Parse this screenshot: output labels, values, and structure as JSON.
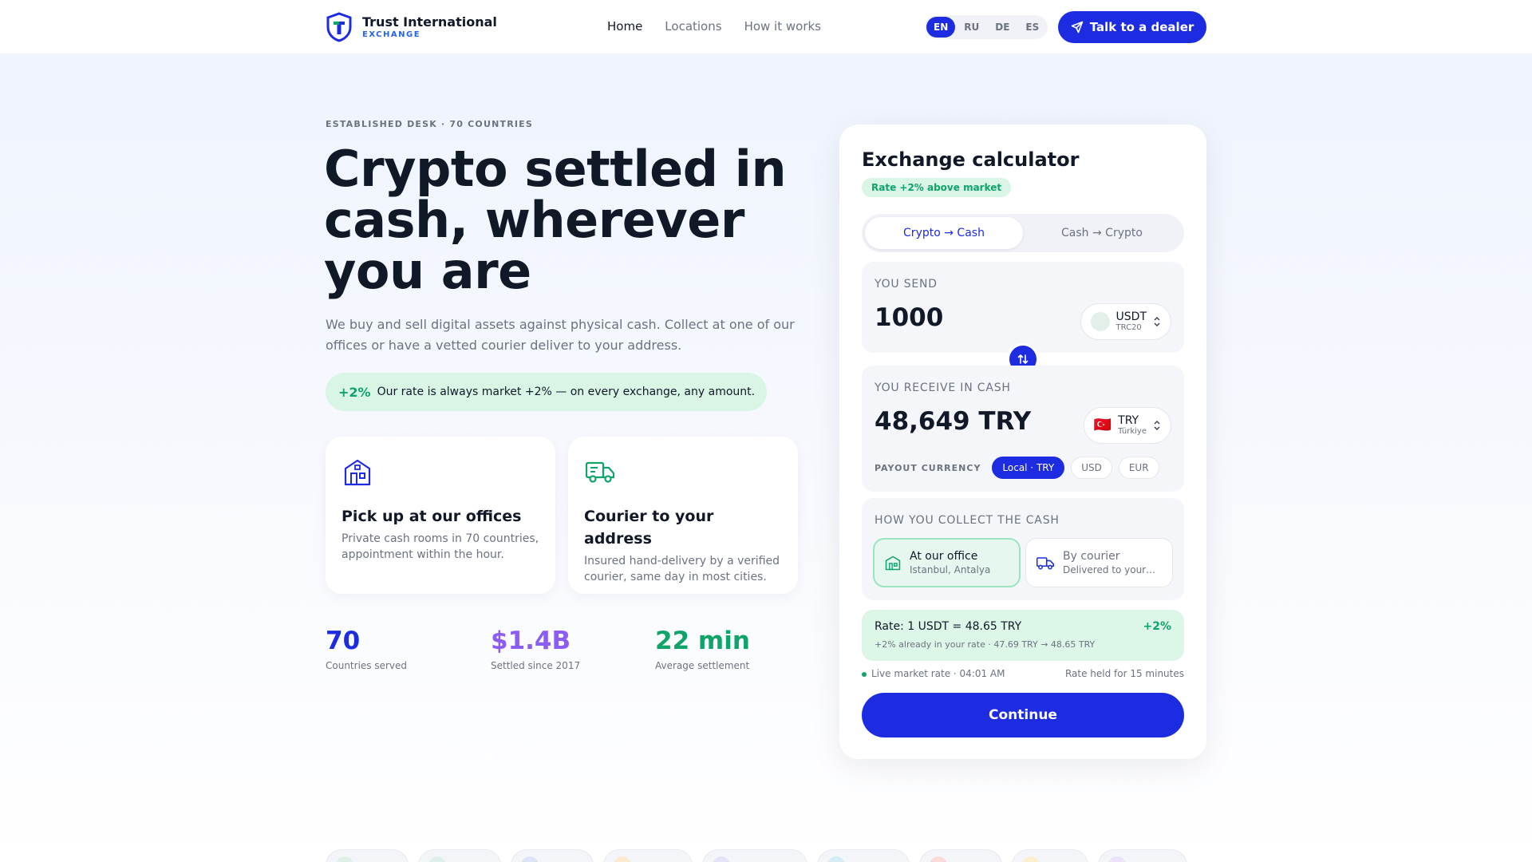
{
  "header": {
    "brand_name": "Trust International",
    "brand_sub": "EXCHANGE",
    "nav": [
      {
        "label": "Home",
        "active": true
      },
      {
        "label": "Locations",
        "active": false
      },
      {
        "label": "How it works",
        "active": false
      }
    ],
    "languages": [
      "EN",
      "RU",
      "DE",
      "ES"
    ],
    "active_language": "EN",
    "cta_label": "Talk to a dealer",
    "cta_icon": "send-icon"
  },
  "hero": {
    "eyebrow": "ESTABLISHED DESK · 70 COUNTRIES",
    "title": "Crypto settled in cash, wherever you are",
    "description": "We buy and sell digital assets against physical cash. Collect at one of our offices or have a vetted courier deliver to your address.",
    "rate_plus": "+2%",
    "rate_text": "Our rate is always market +2% — on every exchange, any amount."
  },
  "features": [
    {
      "icon": "office-building-icon",
      "title": "Pick up at our offices",
      "text": "Private cash rooms in 70 countries, appointment within the hour."
    },
    {
      "icon": "delivery-truck-icon",
      "title": "Courier to your address",
      "text": "Insured hand-delivery by a verified courier, same day in most cities."
    }
  ],
  "stats": [
    {
      "value": "70",
      "label": "Countries served",
      "color": "#1d2ce0"
    },
    {
      "value": "$1.4B",
      "label": "Settled since 2017",
      "color": "#8b5cf6"
    },
    {
      "value": "22 min",
      "label": "Average settlement",
      "color": "#10a36a"
    }
  ],
  "calculator": {
    "title": "Exchange calculator",
    "badge": "Rate +2% above market",
    "modes": [
      {
        "label": "Crypto → Cash",
        "active": true
      },
      {
        "label": "Cash → Crypto",
        "active": false
      }
    ],
    "send": {
      "label": "YOU SEND",
      "amount": "1000",
      "currency": "USDT",
      "network": "TRC20"
    },
    "receive": {
      "label": "YOU RECEIVE IN CASH",
      "amount": "48,649 TRY",
      "currency": "TRY",
      "country": "Türkiye",
      "flag": "🇹🇷"
    },
    "payout": {
      "label": "PAYOUT CURRENCY",
      "options": [
        {
          "label": "Local · TRY",
          "active": true
        },
        {
          "label": "USD",
          "active": false
        },
        {
          "label": "EUR",
          "active": false
        }
      ]
    },
    "collect": {
      "label": "HOW YOU COLLECT THE CASH",
      "options": [
        {
          "title": "At our office",
          "sub": "Istanbul, Antalya",
          "icon": "office-building-icon",
          "active": true
        },
        {
          "title": "By courier",
          "sub": "Delivered to your…",
          "icon": "delivery-truck-icon",
          "active": false
        }
      ]
    },
    "rate": {
      "line": "Rate: 1 USDT = 48.65 TRY",
      "plus": "+2%",
      "note": "+2% already in your rate · 47.69 TRY → 48.65 TRY"
    },
    "live_text": "Live market rate · 04:01 AM",
    "held_text": "Rate held for 15 minutes",
    "continue_label": "Continue"
  },
  "colors": {
    "accent": "#1d2ce0",
    "green": "#10a36a",
    "purple": "#8b5cf6"
  }
}
